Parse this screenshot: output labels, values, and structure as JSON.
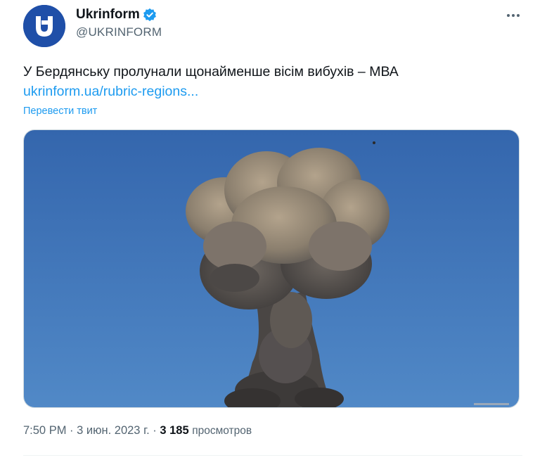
{
  "author": {
    "display_name": "Ukrinform",
    "handle": "@UKRINFORM",
    "verified": true,
    "avatar_icon": "ukrinform-logo",
    "avatar_color": "#1f4fa8"
  },
  "tweet": {
    "text": "У Бердянську пролунали щонайменше вісім вибухів – МВА",
    "link": "ukrinform.ua/rubric-regions...",
    "translate_label": "Перевести твит",
    "image_icon": "explosion-smoke-photo"
  },
  "meta": {
    "time": "7:50 PM",
    "separator": "·",
    "date": "3 июн. 2023 г.",
    "views_count": "3 185",
    "views_label": "просмотров"
  },
  "colors": {
    "accent": "#1d9bf0",
    "text": "#0f1419",
    "secondary": "#536471",
    "sky_top": "#3566aa",
    "sky_bottom": "#4f86c6"
  }
}
